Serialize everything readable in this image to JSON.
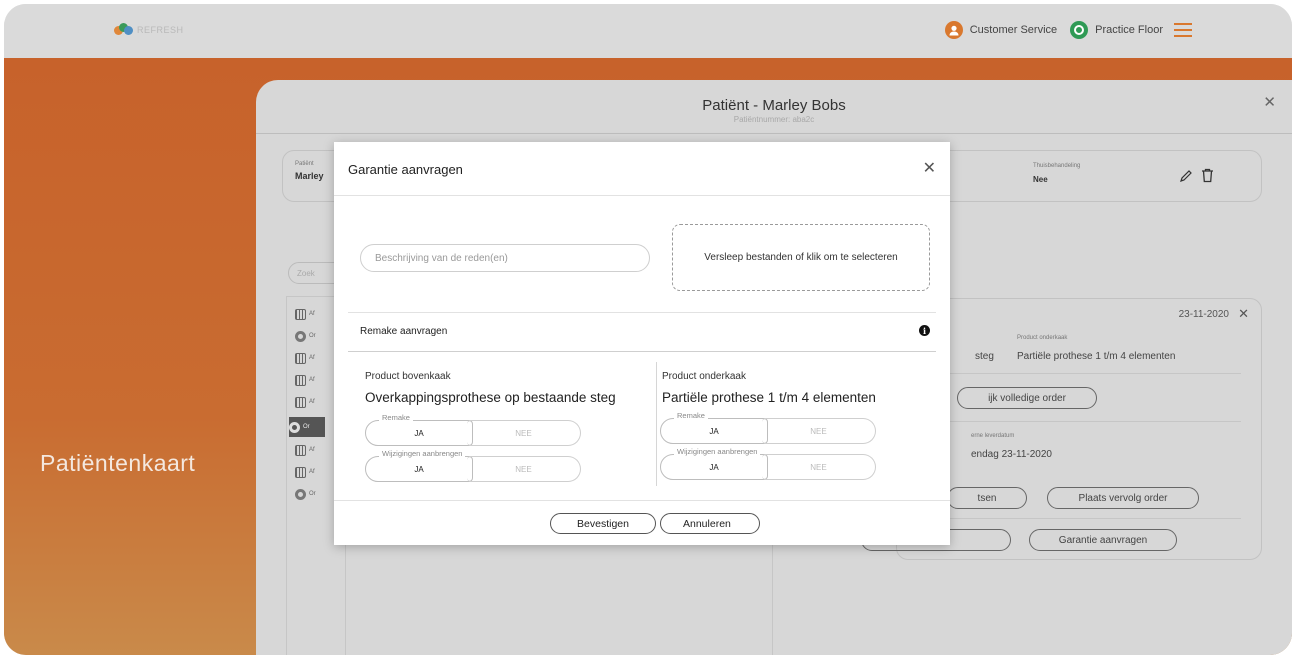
{
  "topbar": {
    "logo_text": "REFRESH",
    "user_role": "Customer Service",
    "location": "Practice Floor",
    "colors": {
      "user_icon": "#d9782e",
      "location_icon": "#2f9a55",
      "menu": "#d9782e"
    }
  },
  "sidebar": {
    "title": "Patiëntenkaart"
  },
  "card": {
    "title": "Patiënt - Marley Bobs",
    "subtitle": "Patiëntnummer: aba2c",
    "patient_label": "Patiënt",
    "patient_value": "Marley",
    "home_treatment_label": "Thuisbehandeling",
    "home_treatment_value": "Nee",
    "search_placeholder": "Zoek",
    "list_items": [
      {
        "icon": "calendar-icon",
        "label": "Af"
      },
      {
        "icon": "gear-icon",
        "label": "Or"
      },
      {
        "icon": "calendar-icon",
        "label": "Af"
      },
      {
        "icon": "calendar-icon",
        "label": "Af"
      },
      {
        "icon": "calendar-icon",
        "label": "Af"
      },
      {
        "icon": "gear-icon",
        "label": "Or",
        "selected": true
      },
      {
        "icon": "calendar-icon",
        "label": "Af"
      },
      {
        "icon": "calendar-icon",
        "label": "Af"
      },
      {
        "icon": "gear-icon",
        "label": "Or"
      }
    ],
    "order": {
      "date": "23-11-2020",
      "product_lower_label": "Product onderkaak",
      "product_upper_partial": "steg",
      "product_lower_value": "Partiële prothese 1 t/m 4 elementen",
      "view_full_order": "ijk volledige order",
      "delivery_label": "erne leverdatum",
      "delivery_value": "endag 23-11-2020",
      "btn_partial": "tsen",
      "btn_follow_up": "Plaats vervolg order",
      "btn_partial2": "n",
      "btn_warranty": "Garantie aanvragen"
    }
  },
  "modal": {
    "title": "Garantie aanvragen",
    "reason_placeholder": "Beschrijving van de reden(en)",
    "dropzone_text": "Versleep bestanden of klik om te selecteren",
    "remake_section": "Remake aanvragen",
    "upper": {
      "label": "Product bovenkaak",
      "name": "Overkappingsprothese op bestaande steg",
      "remake_legend": "Remake",
      "changes_legend": "Wijzigingen aanbrengen"
    },
    "lower": {
      "label": "Product onderkaak",
      "name": "Partiële prothese 1 t/m 4 elementen",
      "remake_legend": "Remake",
      "changes_legend": "Wijzigingen aanbrengen"
    },
    "yes_label": "JA",
    "no_label": "NEE",
    "confirm_label": "Bevestigen",
    "cancel_label": "Annuleren"
  }
}
